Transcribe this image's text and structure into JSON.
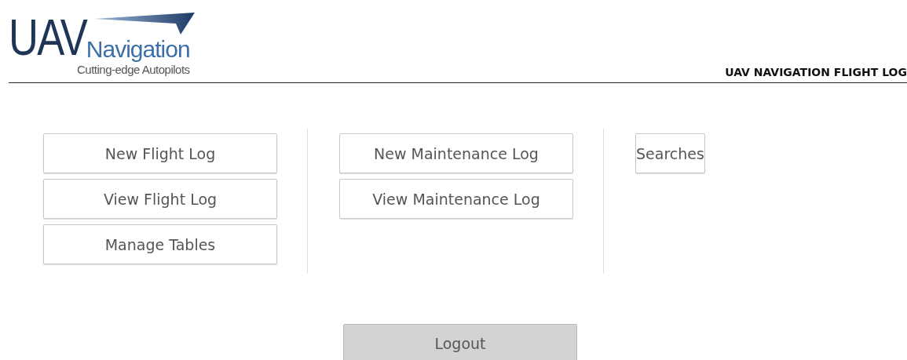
{
  "logo": {
    "primary": "UAV",
    "secondary": "Navigation",
    "tagline": "Cutting-edge Autopilots"
  },
  "header": {
    "title": "UAV NAVIGATION FLIGHT LOG"
  },
  "columns": [
    {
      "buttons": [
        "New Flight Log",
        "View Flight Log",
        "Manage Tables"
      ]
    },
    {
      "buttons": [
        "New Maintenance Log",
        "View Maintenance Log"
      ]
    },
    {
      "buttons": [
        "Searches"
      ]
    }
  ],
  "logout": {
    "label": "Logout"
  }
}
